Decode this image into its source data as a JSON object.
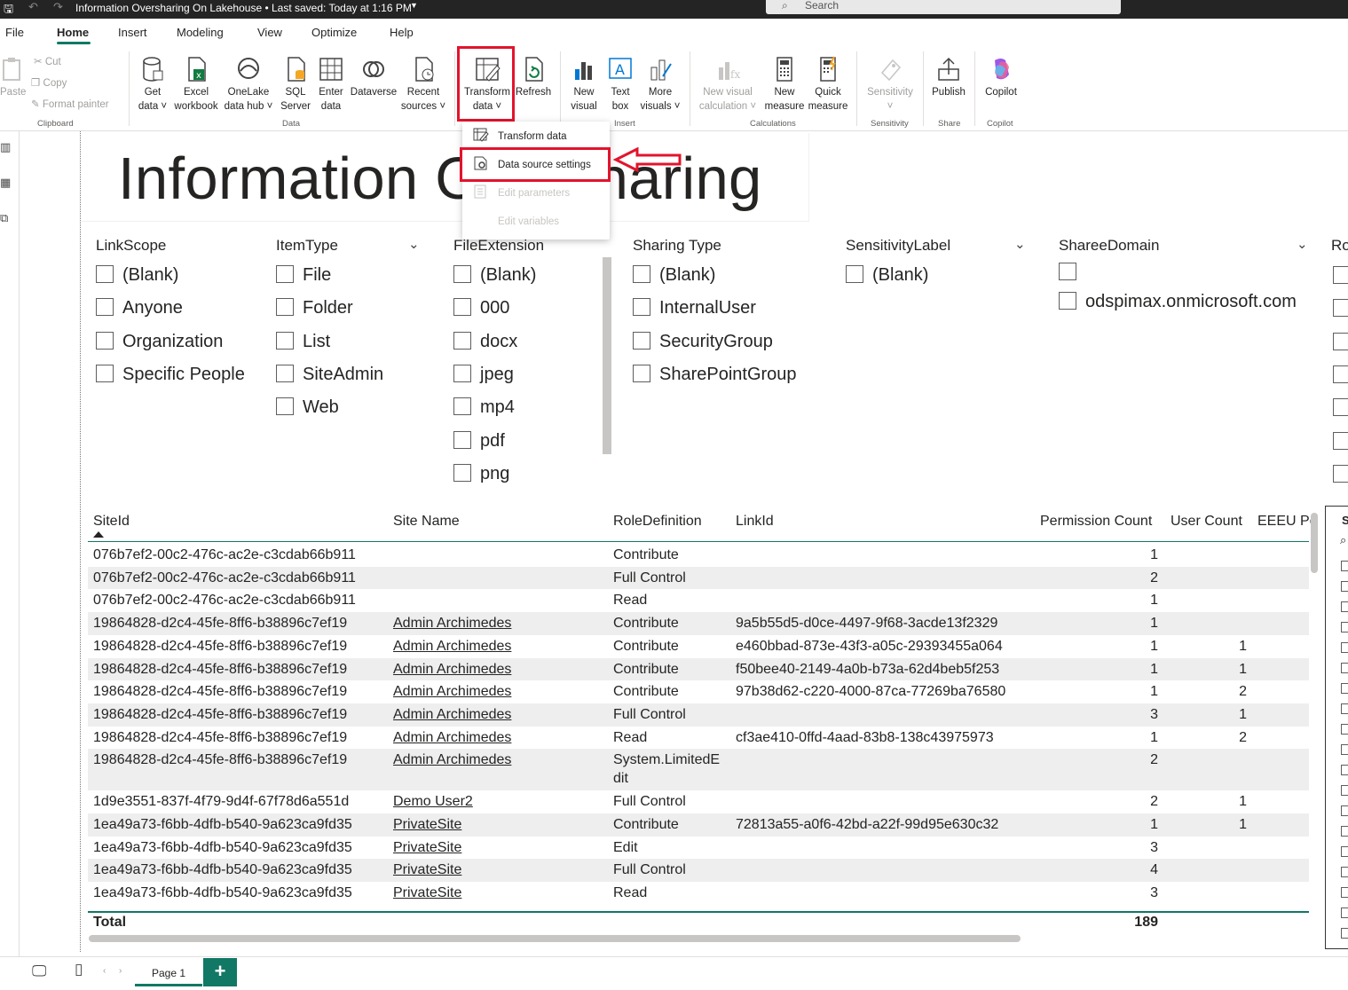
{
  "window": {
    "title": "Information Oversharing On Lakehouse • Last saved: Today at 1:16 PM",
    "search_placeholder": "Search"
  },
  "menu": {
    "tabs": [
      "File",
      "Home",
      "Insert",
      "Modeling",
      "View",
      "Optimize",
      "Help"
    ],
    "active": "Home"
  },
  "ribbon": {
    "clipboard": {
      "paste": "Paste",
      "cut": "Cut",
      "copy": "Copy",
      "format_painter": "Format painter",
      "group": "Clipboard"
    },
    "data": {
      "get_data": [
        "Get",
        "data"
      ],
      "excel": [
        "Excel",
        "workbook"
      ],
      "onelake": [
        "OneLake",
        "data hub"
      ],
      "sql": [
        "SQL",
        "Server"
      ],
      "enter": [
        "Enter",
        "data"
      ],
      "dataverse": "Dataverse",
      "recent": [
        "Recent",
        "sources"
      ],
      "group": "Data"
    },
    "queries": {
      "transform": [
        "Transform",
        "data"
      ],
      "refresh": "Refresh"
    },
    "insert": {
      "new_visual": [
        "New",
        "visual"
      ],
      "text_box": [
        "Text",
        "box"
      ],
      "more_visuals": [
        "More",
        "visuals"
      ],
      "group": "Insert"
    },
    "calculations": {
      "new_visual_calc": [
        "New visual",
        "calculation"
      ],
      "new_measure": [
        "New",
        "measure"
      ],
      "quick_measure": [
        "Quick",
        "measure"
      ],
      "group": "Calculations"
    },
    "sensitivity": {
      "label": "Sensitivity",
      "group": "Sensitivity"
    },
    "share": {
      "publish": "Publish",
      "group": "Share"
    },
    "copilot": {
      "label": "Copilot",
      "group": "Copilot"
    }
  },
  "dropdown": {
    "items": [
      "Transform data",
      "Data source settings",
      "Edit parameters",
      "Edit variables"
    ]
  },
  "report": {
    "title": "Information Oversharing"
  },
  "slicers": [
    {
      "title": "LinkScope",
      "options": [
        "(Blank)",
        "Anyone",
        "Organization",
        "Specific People"
      ]
    },
    {
      "title": "ItemType",
      "options": [
        "File",
        "Folder",
        "List",
        "SiteAdmin",
        "Web"
      ]
    },
    {
      "title": "FileExtension",
      "options": [
        "(Blank)",
        "000",
        "docx",
        "jpeg",
        "mp4",
        "pdf",
        "png"
      ]
    },
    {
      "title": "Sharing Type",
      "options": [
        "(Blank)",
        "InternalUser",
        "SecurityGroup",
        "SharePointGroup"
      ]
    },
    {
      "title": "SensitivityLabel",
      "options": [
        "(Blank)"
      ]
    },
    {
      "title": "ShareeDomain",
      "options": [
        "",
        "odspimax.onmicrosoft.com"
      ]
    },
    {
      "title": "Ro",
      "options": []
    }
  ],
  "table": {
    "headers": [
      "SiteId",
      "Site Name",
      "RoleDefinition",
      "LinkId",
      "Permission Count",
      "User Count",
      "EEEU Pe"
    ],
    "rows": [
      {
        "siteid": "076b7ef2-00c2-476c-ac2e-c3cdab66b911",
        "name": "",
        "role": "Contribute",
        "link": "",
        "perm": "1",
        "users": ""
      },
      {
        "siteid": "076b7ef2-00c2-476c-ac2e-c3cdab66b911",
        "name": "",
        "role": "Full Control",
        "link": "",
        "perm": "2",
        "users": ""
      },
      {
        "siteid": "076b7ef2-00c2-476c-ac2e-c3cdab66b911",
        "name": "",
        "role": "Read",
        "link": "",
        "perm": "1",
        "users": ""
      },
      {
        "siteid": "19864828-d2c4-45fe-8ff6-b38896c7ef19",
        "name": "Admin Archimedes",
        "role": "Contribute",
        "link": "9a5b55d5-d0ce-4497-9f68-3acde13f2329",
        "perm": "1",
        "users": ""
      },
      {
        "siteid": "19864828-d2c4-45fe-8ff6-b38896c7ef19",
        "name": "Admin Archimedes",
        "role": "Contribute",
        "link": "e460bbad-873e-43f3-a05c-29393455a064",
        "perm": "1",
        "users": "1"
      },
      {
        "siteid": "19864828-d2c4-45fe-8ff6-b38896c7ef19",
        "name": "Admin Archimedes",
        "role": "Contribute",
        "link": "f50bee40-2149-4a0b-b73a-62d4beb5f253",
        "perm": "1",
        "users": "1"
      },
      {
        "siteid": "19864828-d2c4-45fe-8ff6-b38896c7ef19",
        "name": "Admin Archimedes",
        "role": "Contribute",
        "link": "97b38d62-c220-4000-87ca-77269ba76580",
        "perm": "1",
        "users": "2"
      },
      {
        "siteid": "19864828-d2c4-45fe-8ff6-b38896c7ef19",
        "name": "Admin Archimedes",
        "role": "Full Control",
        "link": "",
        "perm": "3",
        "users": "1"
      },
      {
        "siteid": "19864828-d2c4-45fe-8ff6-b38896c7ef19",
        "name": "Admin Archimedes",
        "role": "Read",
        "link": "cf3ae410-0ffd-4aad-83b8-138c43975973",
        "perm": "1",
        "users": "2"
      },
      {
        "siteid": "19864828-d2c4-45fe-8ff6-b38896c7ef19",
        "name": "Admin Archimedes",
        "role": "System.LimitedE",
        "role2": "dit",
        "link": "",
        "perm": "2",
        "users": ""
      },
      {
        "siteid": "1d9e3551-837f-4f79-9d4f-67f78d6a551d",
        "name": "Demo User2",
        "role": "Full Control",
        "link": "",
        "perm": "2",
        "users": "1"
      },
      {
        "siteid": "1ea49a73-f6bb-4dfb-b540-9a623ca9fd35",
        "name": "PrivateSite",
        "role": "Contribute",
        "link": "72813a55-a0f6-42bd-a22f-99d95e630c32",
        "perm": "1",
        "users": "1"
      },
      {
        "siteid": "1ea49a73-f6bb-4dfb-b540-9a623ca9fd35",
        "name": "PrivateSite",
        "role": "Edit",
        "link": "",
        "perm": "3",
        "users": ""
      },
      {
        "siteid": "1ea49a73-f6bb-4dfb-b540-9a623ca9fd35",
        "name": "PrivateSite",
        "role": "Full Control",
        "link": "",
        "perm": "4",
        "users": ""
      },
      {
        "siteid": "1ea49a73-f6bb-4dfb-b540-9a623ca9fd35",
        "name": "PrivateSite",
        "role": "Read",
        "link": "",
        "perm": "3",
        "users": ""
      }
    ],
    "total_label": "Total",
    "total_value": "189"
  },
  "pages": {
    "tabs": [
      "Page 1"
    ],
    "add": "+"
  },
  "colors": {
    "accent": "#117865",
    "highlight": "#e3132c"
  }
}
